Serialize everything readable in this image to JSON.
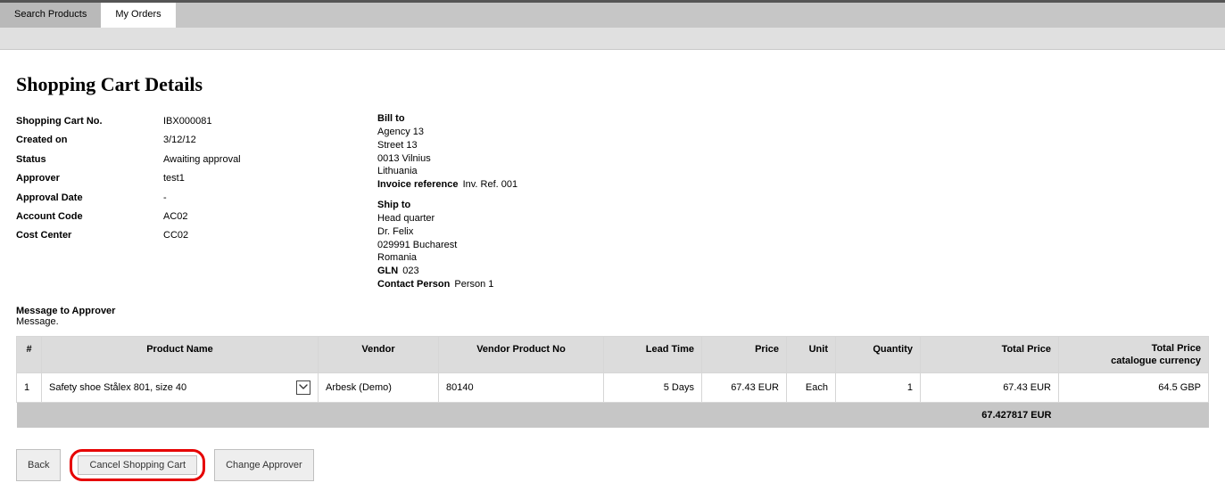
{
  "tabs": {
    "search": "Search Products",
    "myorders": "My Orders"
  },
  "page_title": "Shopping Cart Details",
  "details_left": {
    "cart_no": {
      "label": "Shopping Cart No.",
      "value": "IBX000081"
    },
    "created": {
      "label": "Created on",
      "value": "3/12/12"
    },
    "status": {
      "label": "Status",
      "value": "Awaiting approval"
    },
    "approver": {
      "label": "Approver",
      "value": "test1"
    },
    "approval_date": {
      "label": "Approval Date",
      "value": "-"
    },
    "account_code": {
      "label": "Account Code",
      "value": "AC02"
    },
    "cost_center": {
      "label": "Cost Center",
      "value": "CC02"
    }
  },
  "bill_to": {
    "label": "Bill to",
    "line1": "Agency 13",
    "line2": "Street 13",
    "line3": "0013  Vilnius",
    "line4": "Lithuania",
    "invoice_ref_label": "Invoice reference",
    "invoice_ref_value": "Inv. Ref. 001"
  },
  "ship_to": {
    "label": "Ship to",
    "line1": "Head quarter",
    "line2": "Dr. Felix",
    "line3": "029991  Bucharest",
    "line4": "Romania",
    "gln_label": "GLN",
    "gln_value": "023",
    "contact_label": "Contact Person",
    "contact_value": "Person 1"
  },
  "message_to_approver_label": "Message to Approver",
  "message_to_approver_value": "Message.",
  "table": {
    "headers": {
      "num": "#",
      "product": "Product Name",
      "vendor": "Vendor",
      "vendor_no": "Vendor Product No",
      "lead_time": "Lead Time",
      "price": "Price",
      "unit": "Unit",
      "qty": "Quantity",
      "total": "Total Price",
      "total_cat_a": "Total Price",
      "total_cat_b": "catalogue currency"
    },
    "rows": [
      {
        "num": "1",
        "product": "Safety shoe Stålex 801, size 40",
        "vendor": "Arbesk (Demo)",
        "vendor_no": "80140",
        "lead_time": "5 Days",
        "price": "67.43 EUR",
        "unit": "Each",
        "qty": "1",
        "total": "67.43 EUR",
        "total_cat": "64.5 GBP"
      }
    ],
    "footer_total": "67.427817 EUR"
  },
  "actions": {
    "back": "Back",
    "cancel": "Cancel Shopping Cart",
    "change_approver": "Change Approver"
  }
}
